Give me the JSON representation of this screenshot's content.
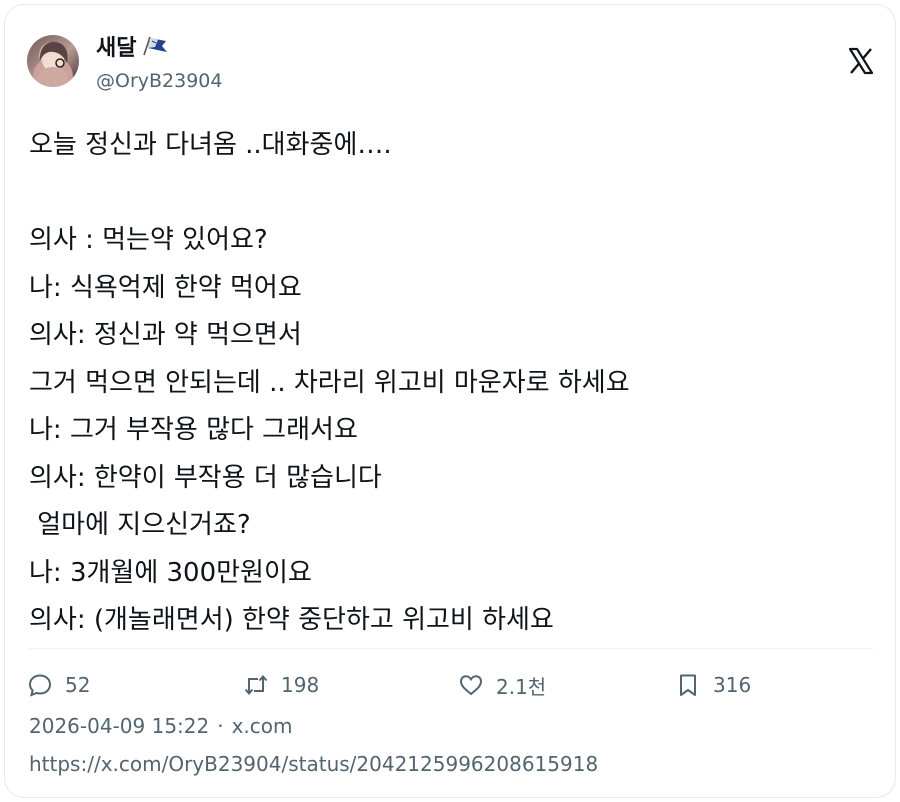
{
  "author": {
    "display_name": "새달",
    "handle": "@OryB23904",
    "avatar": "avatar-photo",
    "badge_icon": "flag-icon"
  },
  "platform_icon": "x-logo-icon",
  "post": {
    "lines": [
      "오늘 정신과 다녀옴 ..대화중에….",
      "",
      "의사 : 먹는약 있어요?",
      "나: 식욕억제 한약 먹어요",
      "의사: 정신과 약 먹으면서",
      "그거 먹으면 안되는데 .. 차라리 위고비 마운자로 하세요",
      "나: 그거 부작용 많다 그래서요",
      "의사: 한약이 부작용 더 많습니다",
      " 얼마에 지으신거죠?",
      "나: 3개월에 300만원이요",
      "의사: (개놀래면서) 한약 중단하고 위고비 하세요"
    ]
  },
  "stats": {
    "replies": "52",
    "reposts": "198",
    "likes": "2.1천",
    "bookmarks": "316"
  },
  "meta": {
    "timestamp": "2026-04-09 15:22",
    "separator": "·",
    "source": "x.com",
    "url": "https://x.com/OryB23904/status/2042125996208615918"
  }
}
